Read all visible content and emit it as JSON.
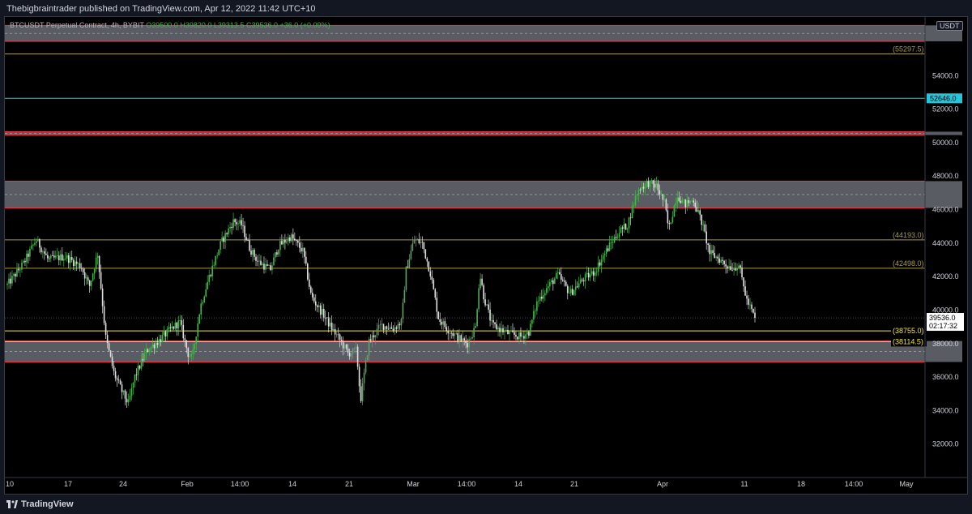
{
  "header": {
    "published_text": "Thebigbraintrader published on TradingView.com, Apr 12, 2022 11:42 UTC+10"
  },
  "legend": {
    "symbol": "BTCUSDT Perpetual Contract, 4h, BYBIT",
    "open": "O39500.0",
    "high": "H39820.0",
    "low": "L39313.5",
    "close": "C39536.0",
    "change": "+36.0 (+0.09%)"
  },
  "currency_label": "USDT",
  "footer": {
    "brand": "TradingView"
  },
  "colors": {
    "background": "#000000",
    "up_candle": "#4caf50",
    "down_candle": "#e0e0e0",
    "zone_fill": "#787b86",
    "zone_border": "#f23645",
    "cyan_line": "#26c6da",
    "olive_line": "#a79b47",
    "yellow_line": "#f5e642"
  },
  "chart_data": {
    "type": "candlestick",
    "symbol": "BTCUSDT Perpetual Contract, 4h, BYBIT",
    "ylim": [
      30000,
      57500
    ],
    "y_ticks": [
      32000,
      34000,
      36000,
      38000,
      40000,
      42000,
      44000,
      46000,
      48000,
      50000,
      52000,
      54000
    ],
    "y_tick_labels": [
      "32000.0",
      "34000.0",
      "36000.0",
      "38000.0",
      "40000.0",
      "42000.0",
      "44000.0",
      "46000.0",
      "48000.0",
      "50000.0",
      "52000.0",
      "54000.0"
    ],
    "x_tick_labels": [
      "10",
      "17",
      "24",
      "Feb",
      "14:00",
      "14",
      "21",
      "Mar",
      "14:00",
      "14",
      "21",
      "Apr",
      "11",
      "18",
      "14:00",
      "May"
    ],
    "grid": false,
    "horizontal_levels": [
      {
        "value": 55297.5,
        "label": "(55297.5)",
        "style": "olive"
      },
      {
        "value": 52646.0,
        "label": "52646.0",
        "style": "cyan"
      },
      {
        "value": 44193.0,
        "label": "(44193.0)",
        "style": "olive"
      },
      {
        "value": 42498.0,
        "label": "(42498.0)",
        "style": "olive"
      },
      {
        "value": 38755.0,
        "label": "(38755.0)",
        "style": "yellow"
      },
      {
        "value": 38114.5,
        "label": "(38114.5)",
        "style": "yellow"
      }
    ],
    "zones": [
      {
        "top": 57000,
        "bottom": 56050
      },
      {
        "top": 50650,
        "bottom": 50450
      },
      {
        "top": 47700,
        "bottom": 46100
      },
      {
        "top": 38150,
        "bottom": 36900
      }
    ],
    "current_price": {
      "value": 39536.0,
      "label": "39536.0",
      "countdown": "02:17:32"
    },
    "series": [
      {
        "anchors": [
          [
            0,
            41500
          ],
          [
            4,
            42800
          ],
          [
            7,
            44200
          ],
          [
            10,
            43000
          ],
          [
            14,
            43200
          ],
          [
            18,
            42600
          ],
          [
            20,
            41400
          ],
          [
            22,
            43400
          ],
          [
            24,
            38300
          ],
          [
            26,
            36200
          ],
          [
            28,
            35100
          ],
          [
            29.5,
            34400
          ],
          [
            31,
            36000
          ],
          [
            34,
            37600
          ],
          [
            37,
            38200
          ],
          [
            40,
            38900
          ],
          [
            42,
            39300
          ],
          [
            44,
            37400
          ],
          [
            45,
            37100
          ],
          [
            47,
            40200
          ],
          [
            49,
            41900
          ],
          [
            52,
            44000
          ],
          [
            55,
            45300
          ],
          [
            57,
            45100
          ],
          [
            59,
            43700
          ],
          [
            61,
            42900
          ],
          [
            64,
            42400
          ],
          [
            66,
            43800
          ],
          [
            69,
            44400
          ],
          [
            72,
            43500
          ],
          [
            74,
            40800
          ],
          [
            77,
            39700
          ],
          [
            79,
            38900
          ],
          [
            81,
            38200
          ],
          [
            83,
            37400
          ],
          [
            85,
            37600
          ],
          [
            86,
            34600
          ],
          [
            88,
            38100
          ],
          [
            91,
            39100
          ],
          [
            94,
            38900
          ],
          [
            96,
            39300
          ],
          [
            97,
            42300
          ],
          [
            99,
            44200
          ],
          [
            101,
            44000
          ],
          [
            103,
            42200
          ],
          [
            105,
            39500
          ],
          [
            107,
            38900
          ],
          [
            110,
            38300
          ],
          [
            112,
            38000
          ],
          [
            114,
            39000
          ],
          [
            115,
            42200
          ],
          [
            116,
            40800
          ],
          [
            118,
            39100
          ],
          [
            122,
            38600
          ],
          [
            125,
            38400
          ],
          [
            127,
            38700
          ],
          [
            129,
            40500
          ],
          [
            131,
            41200
          ],
          [
            134,
            42100
          ],
          [
            137,
            41000
          ],
          [
            140,
            41800
          ],
          [
            143,
            42300
          ],
          [
            145,
            43200
          ],
          [
            147,
            44000
          ],
          [
            149,
            44700
          ],
          [
            151,
            45100
          ],
          [
            153,
            46800
          ],
          [
            154,
            47300
          ],
          [
            156,
            47600
          ],
          [
            158,
            47400
          ],
          [
            160,
            46400
          ],
          [
            161,
            44800
          ],
          [
            163,
            46900
          ],
          [
            165,
            46300
          ],
          [
            167,
            46600
          ],
          [
            169,
            45300
          ],
          [
            171,
            43400
          ],
          [
            173,
            43100
          ],
          [
            175,
            42700
          ],
          [
            177,
            42500
          ],
          [
            178,
            42800
          ],
          [
            180,
            40600
          ],
          [
            182,
            39536
          ]
        ]
      }
    ]
  }
}
